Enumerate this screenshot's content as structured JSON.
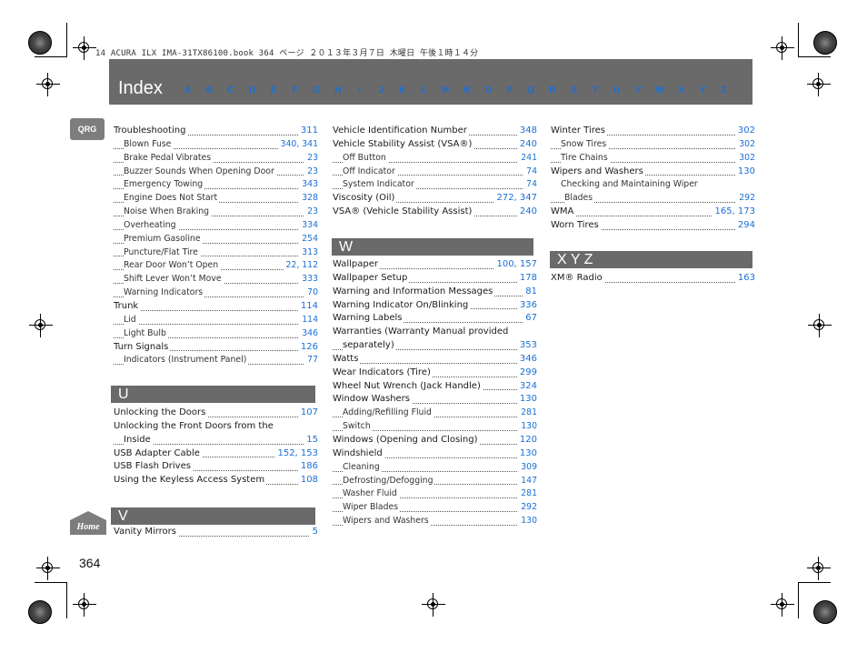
{
  "print_header": "14 ACURA ILX IMA-31TX86100.book  364 ページ  ２０１３年３月７日  木曜日  午後１時１４分",
  "banner": {
    "title": "Index",
    "letters": [
      "A",
      "B",
      "C",
      "D",
      "E",
      "F",
      "G",
      "H",
      "I",
      "J",
      "K",
      "L",
      "M",
      "N",
      "O",
      "P",
      "Q",
      "R",
      "S",
      "T",
      "U",
      "V",
      "W",
      "X",
      "Y",
      "Z"
    ]
  },
  "qrg_label": "QRG",
  "home_label": "Home",
  "page_number": "364",
  "col1": {
    "entries": [
      {
        "text": "Troubleshooting",
        "pages": "311",
        "level": 0
      },
      {
        "text": "Blown Fuse",
        "pages": "340, 341",
        "level": 1
      },
      {
        "text": "Brake Pedal Vibrates",
        "pages": "23",
        "level": 1
      },
      {
        "text": "Buzzer Sounds When Opening Door",
        "pages": "23",
        "level": 1
      },
      {
        "text": "Emergency Towing",
        "pages": "343",
        "level": 1
      },
      {
        "text": "Engine Does Not Start",
        "pages": "328",
        "level": 1
      },
      {
        "text": "Noise When Braking",
        "pages": "23",
        "level": 1
      },
      {
        "text": "Overheating",
        "pages": "334",
        "level": 1
      },
      {
        "text": "Premium Gasoline",
        "pages": "254",
        "level": 1
      },
      {
        "text": "Puncture/Flat Tire",
        "pages": "313",
        "level": 1
      },
      {
        "text": "Rear Door Won’t Open",
        "pages": "22, 112",
        "level": 1
      },
      {
        "text": "Shift Lever Won’t Move",
        "pages": "333",
        "level": 1
      },
      {
        "text": "Warning Indicators",
        "pages": "70",
        "level": 1
      },
      {
        "text": "Trunk",
        "pages": "114",
        "level": 0
      },
      {
        "text": "Lid",
        "pages": "114",
        "level": 1
      },
      {
        "text": "Light Bulb",
        "pages": "346",
        "level": 1
      },
      {
        "text": "Turn Signals",
        "pages": "126",
        "level": 0
      },
      {
        "text": "Indicators (Instrument Panel)",
        "pages": "77",
        "level": 1
      }
    ],
    "u_header": "U",
    "u_entries": [
      {
        "text": "Unlocking the Doors",
        "pages": "107",
        "level": 0
      },
      {
        "text": "Unlocking the Front Doors from the",
        "pages": "",
        "level": 0,
        "wrap": "first"
      },
      {
        "text": "Inside",
        "pages": "15",
        "level": 0,
        "wrap": "cont"
      },
      {
        "text": "USB Adapter Cable",
        "pages": "152, 153",
        "level": 0
      },
      {
        "text": "USB Flash Drives",
        "pages": "186",
        "level": 0
      },
      {
        "text": "Using the Keyless Access System",
        "pages": "108",
        "level": 0
      }
    ],
    "v_header": "V",
    "v_entries": [
      {
        "text": "Vanity Mirrors",
        "pages": "5",
        "level": 0
      }
    ]
  },
  "col2": {
    "entries": [
      {
        "text": "Vehicle Identification Number",
        "pages": "348",
        "level": 0
      },
      {
        "text": "Vehicle Stability Assist (VSA®)",
        "pages": "240",
        "level": 0
      },
      {
        "text": "Off Button",
        "pages": "241",
        "level": 1
      },
      {
        "text": "Off Indicator",
        "pages": "74",
        "level": 1
      },
      {
        "text": "System Indicator",
        "pages": "74",
        "level": 1
      },
      {
        "text": "Viscosity (Oil)",
        "pages": "272, 347",
        "level": 0
      },
      {
        "text": "VSA® (Vehicle Stability Assist)",
        "pages": "240",
        "level": 0
      }
    ],
    "w_header": "W",
    "w_entries": [
      {
        "text": "Wallpaper",
        "pages": "100, 157",
        "level": 0
      },
      {
        "text": "Wallpaper Setup",
        "pages": "178",
        "level": 0
      },
      {
        "text": "Warning and Information Messages",
        "pages": "81",
        "level": 0
      },
      {
        "text": "Warning Indicator On/Blinking",
        "pages": "336",
        "level": 0
      },
      {
        "text": "Warning Labels",
        "pages": "67",
        "level": 0
      },
      {
        "text": "Warranties (Warranty Manual provided",
        "pages": "",
        "level": 0,
        "wrap": "first"
      },
      {
        "text": "separately)",
        "pages": "353",
        "level": 0,
        "wrap": "cont"
      },
      {
        "text": "Watts",
        "pages": "346",
        "level": 0
      },
      {
        "text": "Wear Indicators (Tire)",
        "pages": "299",
        "level": 0
      },
      {
        "text": "Wheel Nut Wrench (Jack Handle)",
        "pages": "324",
        "level": 0
      },
      {
        "text": "Window Washers",
        "pages": "130",
        "level": 0
      },
      {
        "text": "Adding/Refilling Fluid",
        "pages": "281",
        "level": 1
      },
      {
        "text": "Switch",
        "pages": "130",
        "level": 1
      },
      {
        "text": "Windows (Opening and Closing)",
        "pages": "120",
        "level": 0
      },
      {
        "text": "Windshield",
        "pages": "130",
        "level": 0
      },
      {
        "text": "Cleaning",
        "pages": "309",
        "level": 1
      },
      {
        "text": "Defrosting/Defogging",
        "pages": "147",
        "level": 1
      },
      {
        "text": "Washer Fluid",
        "pages": "281",
        "level": 1
      },
      {
        "text": "Wiper Blades",
        "pages": "292",
        "level": 1
      },
      {
        "text": "Wipers and Washers",
        "pages": "130",
        "level": 1
      }
    ]
  },
  "col3": {
    "entries": [
      {
        "text": "Winter Tires",
        "pages": "302",
        "level": 0
      },
      {
        "text": "Snow Tires",
        "pages": "302",
        "level": 1
      },
      {
        "text": "Tire Chains",
        "pages": "302",
        "level": 1
      },
      {
        "text": "Wipers and Washers",
        "pages": "130",
        "level": 0
      },
      {
        "text": "Checking and Maintaining Wiper",
        "pages": "",
        "level": 1,
        "wrap": "first"
      },
      {
        "text": "Blades",
        "pages": "292",
        "level": 1,
        "wrap": "cont"
      },
      {
        "text": "WMA",
        "pages": "165, 173",
        "level": 0
      },
      {
        "text": "Worn Tires",
        "pages": "294",
        "level": 0
      }
    ],
    "xyz_header": "X   Y   Z",
    "xyz_entries": [
      {
        "text": "XM® Radio",
        "pages": "163",
        "level": 0
      }
    ]
  },
  "colors": {
    "banner": "#6a6a6a",
    "link": "#1a6fd4",
    "text": "#1a1a1a"
  }
}
